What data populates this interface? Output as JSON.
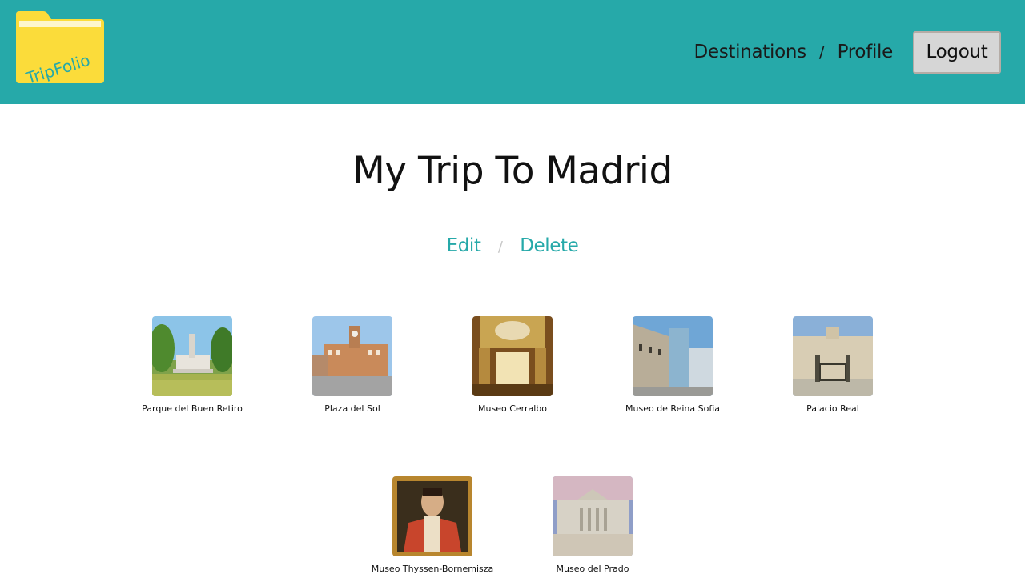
{
  "header": {
    "logo_text": "TripFolio",
    "nav": [
      {
        "label": "Destinations"
      },
      {
        "label": "Profile"
      }
    ],
    "nav_separator": "/",
    "logout_label": "Logout"
  },
  "page": {
    "title": "My Trip To Madrid",
    "actions": {
      "edit": "Edit",
      "separator": "/",
      "delete": "Delete"
    }
  },
  "places": [
    {
      "name": "Parque del Buen Retiro"
    },
    {
      "name": "Plaza del Sol"
    },
    {
      "name": "Museo Cerralbo"
    },
    {
      "name": "Museo de Reina Sofia"
    },
    {
      "name": "Palacio Real"
    },
    {
      "name": "Museo Thyssen-Bornemisza"
    },
    {
      "name": "Museo del Prado"
    }
  ],
  "colors": {
    "header_bg": "#26a9a9",
    "accent": "#26a9a9",
    "logo_folder": "#fbdc3a"
  }
}
